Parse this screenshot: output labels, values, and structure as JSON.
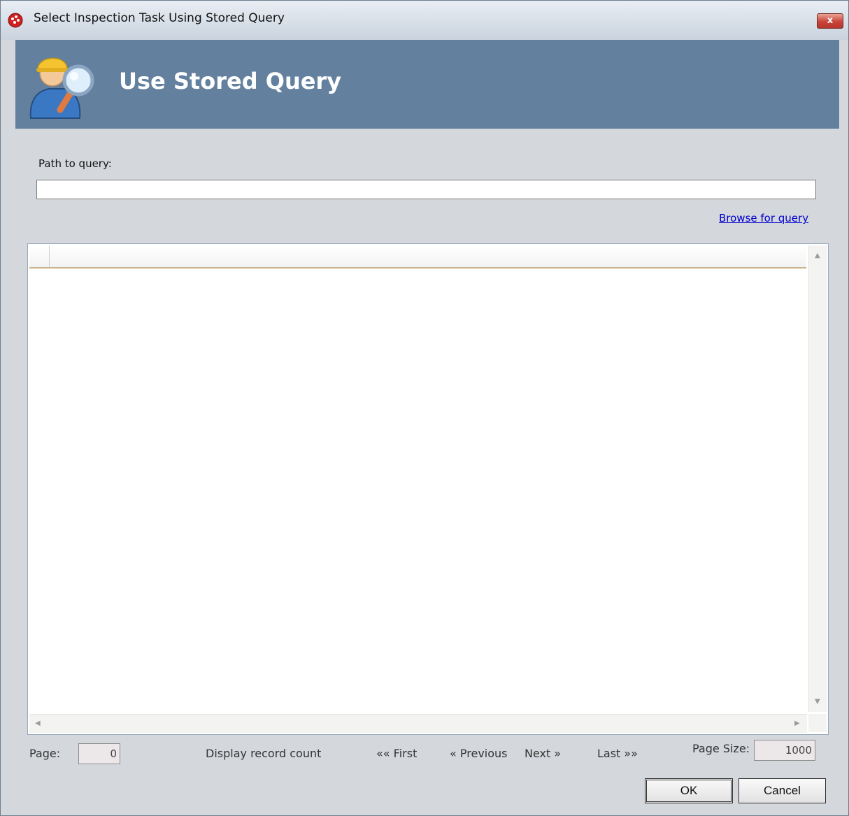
{
  "window": {
    "title": "Select Inspection Task Using Stored Query",
    "close_label": "x"
  },
  "banner": {
    "title": "Use Stored Query",
    "icon": "inspector-magnifier-icon"
  },
  "form": {
    "path_label": "Path to query:",
    "path_value": "",
    "browse_link": "Browse for query"
  },
  "grid": {
    "columns": [],
    "rows": []
  },
  "footer": {
    "page_label": "Page:",
    "page_value": "0",
    "display_count": "Display record count",
    "first": "«« First",
    "previous": "« Previous",
    "next": "Next »",
    "last": "Last »»",
    "page_size_label": "Page Size:",
    "page_size_value": "1000"
  },
  "buttons": {
    "ok": "OK",
    "cancel": "Cancel"
  },
  "colors": {
    "banner": "#63809f",
    "link": "#0000cc",
    "close": "#c9453a"
  }
}
